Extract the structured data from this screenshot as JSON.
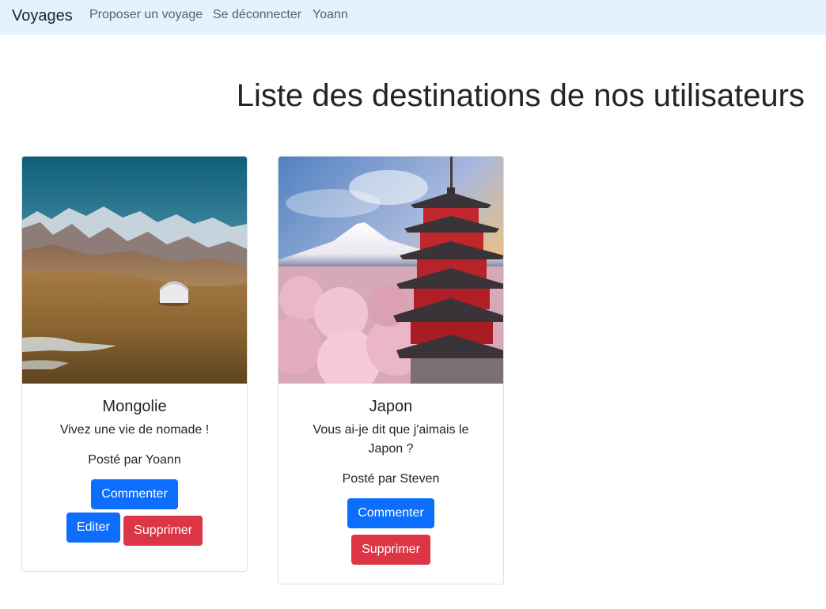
{
  "navbar": {
    "brand": "Voyages",
    "links": [
      {
        "label": "Proposer un voyage"
      },
      {
        "label": "Se déconnecter"
      },
      {
        "label": "Yoann"
      }
    ]
  },
  "page": {
    "title": "Liste des destinations de nos utilisateurs"
  },
  "cards": [
    {
      "title": "Mongolie",
      "description": "Vivez une vie de nomade !",
      "author": "Posté par Yoann",
      "image": "mongolia-landscape-yurt-image",
      "buttons": {
        "comment": "Commenter",
        "edit": "Editer",
        "delete": "Supprimer"
      }
    },
    {
      "title": "Japon",
      "description": "Vous ai-je dit que j'aimais le Japon ?",
      "author": "Posté par Steven",
      "image": "japan-pagoda-fuji-image",
      "buttons": {
        "comment": "Commenter",
        "delete": "Supprimer"
      }
    }
  ],
  "colors": {
    "navbar_bg": "#e3f2fd",
    "primary": "#0d6efd",
    "danger": "#dc3545"
  }
}
